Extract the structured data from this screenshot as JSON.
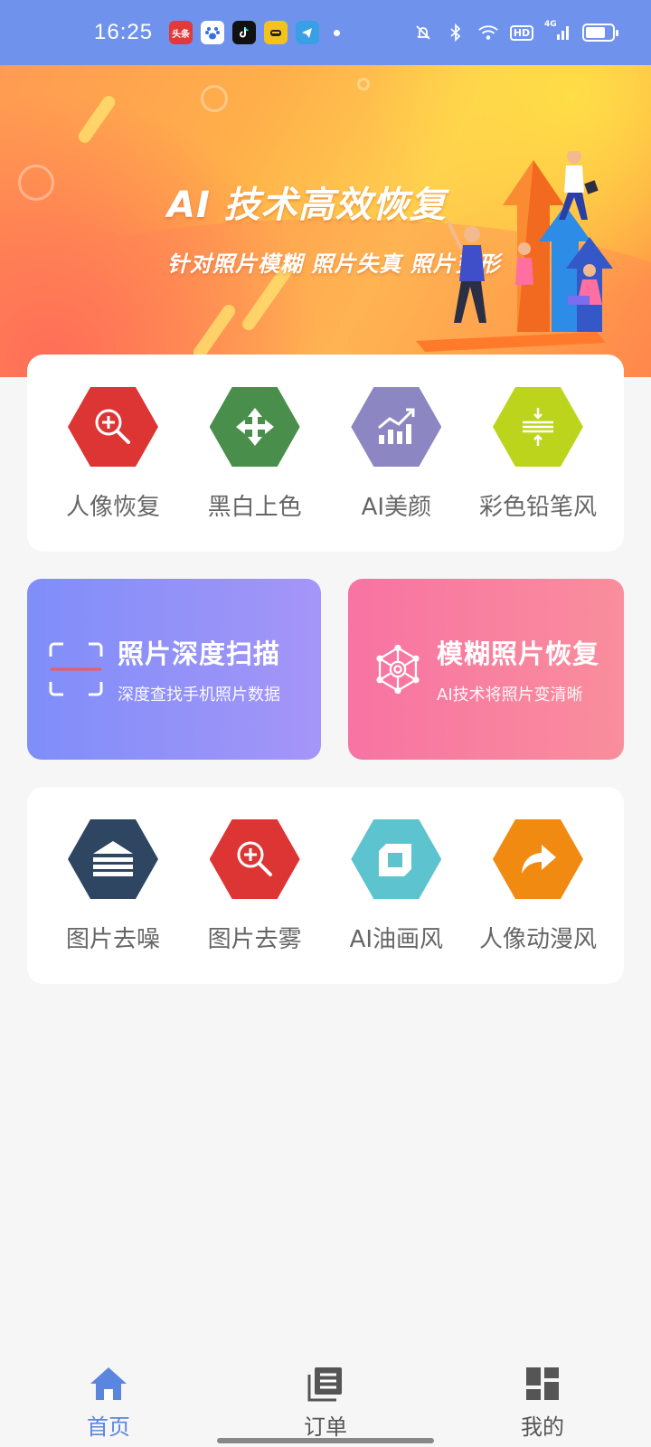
{
  "status_bar": {
    "time": "16:25",
    "notification_icons": [
      "toutiao-icon",
      "baidu-icon",
      "tiktok-icon",
      "app-icon",
      "telegram-icon"
    ],
    "toutiao_label": "头条",
    "network": "4G",
    "hd": "HD",
    "battery_level": 0.75
  },
  "banner": {
    "title": "AI 技术高效恢复",
    "subtitle": "针对照片模糊  照片失真  照片变形"
  },
  "tools_top": [
    {
      "label": "人像恢复",
      "icon": "magnifier-plus-icon",
      "color": "#dd3434"
    },
    {
      "label": "黑白上色",
      "icon": "move-arrows-icon",
      "color": "#4a8e4c"
    },
    {
      "label": "AI美颜",
      "icon": "trend-chart-icon",
      "color": "#8c87c2"
    },
    {
      "label": "彩色铅笔风",
      "icon": "expand-lines-icon",
      "color": "#bcd51c"
    }
  ],
  "promos": {
    "scan": {
      "title": "照片深度扫描",
      "subtitle": "深度查找手机照片数据"
    },
    "restore": {
      "title": "模糊照片恢复",
      "subtitle": "AI技术将照片变清晰"
    }
  },
  "tools_bottom": [
    {
      "label": "图片去噪",
      "icon": "layers-icon",
      "color": "#2e4661"
    },
    {
      "label": "图片去雾",
      "icon": "magnifier-plus-icon",
      "color": "#dd3434"
    },
    {
      "label": "AI油画风",
      "icon": "frame-icon",
      "color": "#5dc4cf"
    },
    {
      "label": "人像动漫风",
      "icon": "share-arrow-icon",
      "color": "#f08a11"
    }
  ],
  "bottom_nav": [
    {
      "label": "首页",
      "icon": "home-icon",
      "active": true
    },
    {
      "label": "订单",
      "icon": "orders-icon",
      "active": false
    },
    {
      "label": "我的",
      "icon": "dashboard-icon",
      "active": false
    }
  ],
  "colors": {
    "status_bar": "#6f93ec",
    "accent": "#5a86e0",
    "page_bg": "#f6f6f6"
  }
}
